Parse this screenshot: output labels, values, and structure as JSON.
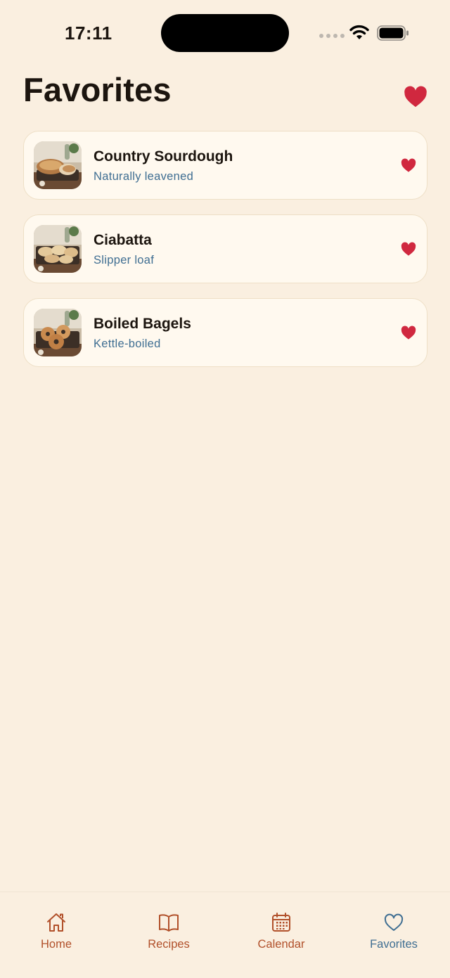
{
  "colors": {
    "background": "#FAEFE0",
    "card": "#FFF9EF",
    "heart": "#D0283F",
    "subtitle": "#3F6E92",
    "tab_inactive": "#B1502A",
    "tab_active": "#3F6E92"
  },
  "status_bar": {
    "time": "17:11"
  },
  "header": {
    "title": "Favorites",
    "icon": "heart-icon"
  },
  "favorites": [
    {
      "title": "Country Sourdough",
      "subtitle": "Naturally leavened",
      "icon": "heart-icon"
    },
    {
      "title": "Ciabatta",
      "subtitle": "Slipper loaf",
      "icon": "heart-icon"
    },
    {
      "title": "Boiled Bagels",
      "subtitle": "Kettle-boiled",
      "icon": "heart-icon"
    }
  ],
  "tab_bar": [
    {
      "label": "Home",
      "icon": "home-icon",
      "active": false
    },
    {
      "label": "Recipes",
      "icon": "book-icon",
      "active": false
    },
    {
      "label": "Calendar",
      "icon": "calendar-icon",
      "active": false
    },
    {
      "label": "Favorites",
      "icon": "heart-outline-icon",
      "active": true
    }
  ]
}
